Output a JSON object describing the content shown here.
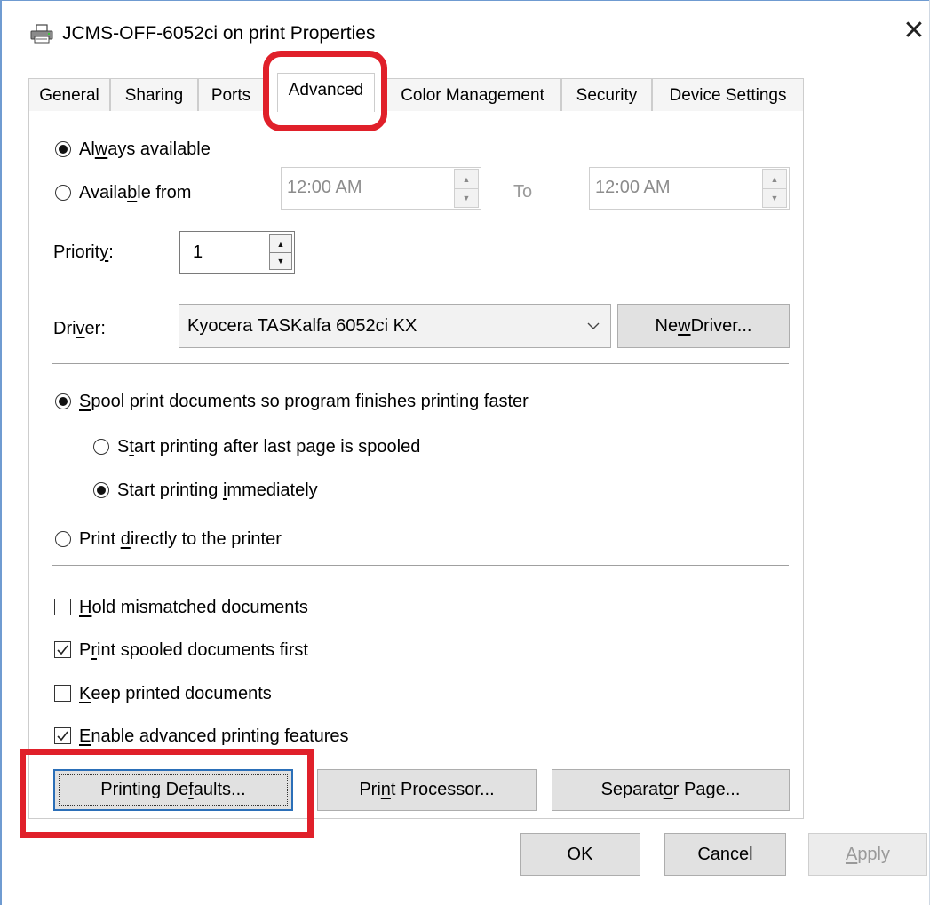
{
  "window": {
    "title": "JCMS-OFF-6052ci on print Properties",
    "close_glyph": "✕"
  },
  "tabs": [
    {
      "label": "General"
    },
    {
      "label": "Sharing"
    },
    {
      "label": "Ports"
    },
    {
      "label": "Advanced",
      "active": true
    },
    {
      "label": "Color Management"
    },
    {
      "label": "Security"
    },
    {
      "label": "Device Settings"
    }
  ],
  "availability": {
    "always_pre": "Al",
    "always_ul": "w",
    "always_post": "ays available",
    "always_selected": true,
    "from_pre": "Availa",
    "from_ul": "b",
    "from_post": "le from",
    "from_selected": false,
    "from_time": "12:00 AM",
    "to_label": "To",
    "to_time": "12:00 AM"
  },
  "priority": {
    "label_pre": "Priorit",
    "label_ul": "y",
    "label_post": ":",
    "value": "1"
  },
  "driver": {
    "label_pre": "Dri",
    "label_ul": "v",
    "label_post": "er:",
    "selected": "Kyocera TASKalfa 6052ci KX",
    "new_driver_pre": "Ne",
    "new_driver_ul": "w",
    "new_driver_post": " Driver..."
  },
  "spool": {
    "main_ul": "S",
    "main_post": "pool print documents so program finishes printing faster",
    "main_selected": true,
    "after_last_pre": "S",
    "after_last_ul": "t",
    "after_last_post": "art printing after last page is spooled",
    "after_last_selected": false,
    "immediately_pre": "Start printing ",
    "immediately_ul": "i",
    "immediately_post": "mmediately",
    "immediately_selected": true,
    "direct_pre": "Print ",
    "direct_ul": "d",
    "direct_post": "irectly to the printer",
    "direct_selected": false
  },
  "options": [
    {
      "pre": "",
      "ul": "H",
      "post": "old mismatched documents",
      "checked": false
    },
    {
      "pre": "P",
      "ul": "r",
      "post": "int spooled documents first",
      "checked": true
    },
    {
      "pre": "",
      "ul": "K",
      "post": "eep printed documents",
      "checked": false
    },
    {
      "pre": "",
      "ul": "E",
      "post": "nable advanced printing features",
      "checked": true
    }
  ],
  "buttons": {
    "printing_defaults_pre": "Printing De",
    "printing_defaults_ul": "f",
    "printing_defaults_post": "aults...",
    "print_processor_pre": "Pri",
    "print_processor_ul": "n",
    "print_processor_post": "t Processor...",
    "separator_page_pre": "Separat",
    "separator_page_ul": "o",
    "separator_page_post": "r Page...",
    "ok": "OK",
    "cancel": "Cancel",
    "apply_ul": "A",
    "apply_post": "pply"
  },
  "colors": {
    "highlight": "#e0202a",
    "window_border": "#6f9bd1",
    "default_button_border": "#2b6fb8"
  }
}
